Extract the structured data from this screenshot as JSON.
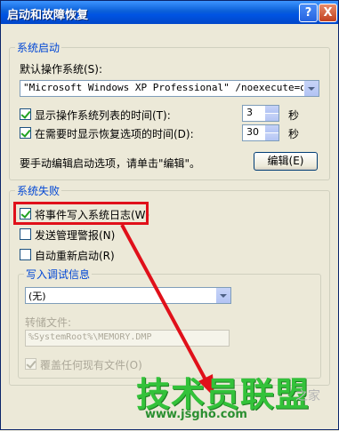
{
  "window": {
    "title": "启动和故障恢复",
    "help_label": "?",
    "close_label": "X"
  },
  "startup": {
    "legend": "系统启动",
    "default_os_label": "默认操作系统(S):",
    "default_os_value": "\"Microsoft Windows XP Professional\" /noexecute=optin",
    "show_os_list": {
      "checked": true,
      "label": "显示操作系统列表的时间(T):",
      "value": "3",
      "unit": "秒"
    },
    "show_recovery": {
      "checked": true,
      "label": "在需要时显示恢复选项的时间(D):",
      "value": "30",
      "unit": "秒"
    },
    "edit_hint": "要手动编辑启动选项，请单击\"编辑\"。",
    "edit_button": "编辑(E)"
  },
  "failure": {
    "legend": "系统失败",
    "write_event": {
      "checked": true,
      "label": "将事件写入系统日志(W)"
    },
    "send_alert": {
      "checked": false,
      "label": "发送管理警报(N)"
    },
    "auto_restart": {
      "checked": false,
      "label": "自动重新启动(R)"
    },
    "debug": {
      "legend": "写入调试信息",
      "selected": "(无)",
      "dump_label": "转储文件:",
      "dump_value": "%SystemRoot%\\MEMORY.DMP",
      "overwrite": {
        "checked": true,
        "label": "覆盖任何现有文件(O)"
      }
    }
  },
  "watermark": {
    "main": "技术员联盟",
    "url": "www.jsgho.com",
    "side": "之家"
  },
  "colors": {
    "title_bar": "#0054e3",
    "dialog_bg": "#ece9d8",
    "highlight": "#e0101a",
    "watermark": "#33c23a"
  }
}
